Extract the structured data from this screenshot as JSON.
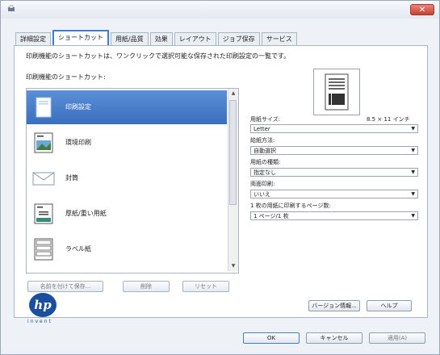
{
  "window": {
    "close_label": "✕"
  },
  "tabs": [
    {
      "label": "詳細設定"
    },
    {
      "label": "ショートカット"
    },
    {
      "label": "用紙/品質"
    },
    {
      "label": "効果"
    },
    {
      "label": "レイアウト"
    },
    {
      "label": "ジョブ保存"
    },
    {
      "label": "サービス"
    }
  ],
  "shortcuts": {
    "description": "印刷機能のショートカットは、ワンクリックで選択可能な保存された印刷設定の一覧です。",
    "list_label": "印刷機能のショートカット:",
    "items": [
      {
        "label": "印刷設定"
      },
      {
        "label": "環境印刷"
      },
      {
        "label": "封筒"
      },
      {
        "label": "厚紙/重い用紙"
      },
      {
        "label": "ラベル紙"
      }
    ],
    "save_as_button": "名前を付けて保存...",
    "delete_button": "削除",
    "reset_button": "リセット"
  },
  "settings": {
    "paper_size_label": "用紙サイズ:",
    "paper_size_dims": "8.5 × 11 インチ",
    "paper_size_value": "Letter",
    "paper_source_label": "給紙方法:",
    "paper_source_value": "自動選択",
    "paper_type_label": "用紙の種類:",
    "paper_type_value": "指定なし",
    "duplex_label": "両面印刷:",
    "duplex_value": "いいえ",
    "pages_per_sheet_label": "1 枚の用紙に印刷するページ数:",
    "pages_per_sheet_value": "1 ページ/1 枚"
  },
  "brand": {
    "logo_text": "hp",
    "logo_caption": "invent"
  },
  "footer": {
    "version_button": "バージョン情報...",
    "help_button": "ヘルプ",
    "ok_button": "OK",
    "cancel_button": "キャンセル",
    "apply_button": "適用(A)"
  }
}
